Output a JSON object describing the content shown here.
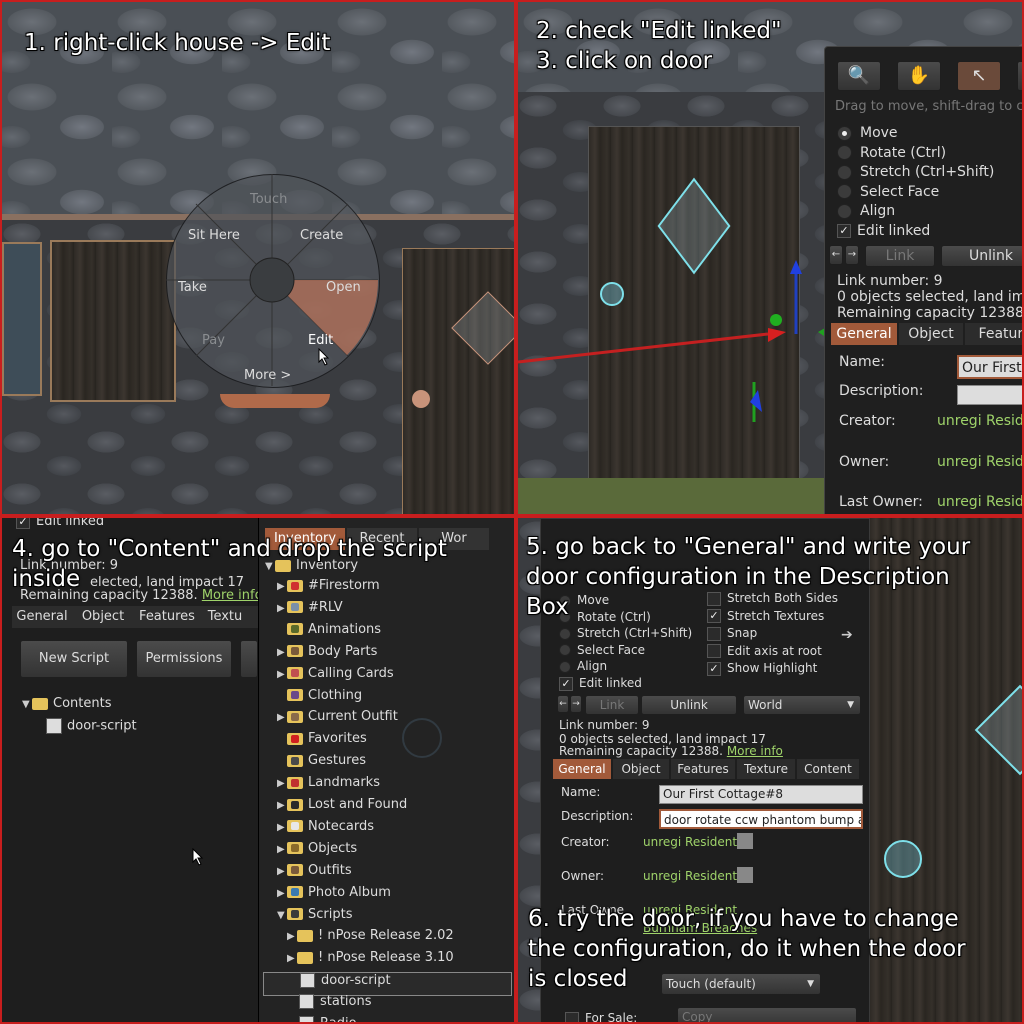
{
  "steps": {
    "s1": "1. right-click house -> Edit",
    "s2": "2. check \"Edit linked\"\n3. click on door",
    "s4": "4. go to \"Content\" and drop the script\ninside",
    "s5": "5. go back to \"General\" and write your\ndoor configuration in the Description\nBox",
    "s6": "6. try the door, if you have to change\nthe configuration, do it when the door\nis closed"
  },
  "pie_menu": {
    "top": "Touch",
    "top_left": "Sit Here",
    "top_right": "Create",
    "left": "Take",
    "right": "Open",
    "bottom_left": "Pay",
    "bottom_right": "Edit",
    "bottom": "More >"
  },
  "edit_tool": {
    "hint": "Drag to move, shift-drag to c",
    "modes": [
      "Move",
      "Rotate (Ctrl)",
      "Stretch (Ctrl+Shift)",
      "Select Face",
      "Align"
    ],
    "edit_linked": "Edit linked",
    "link_btn": "Link",
    "unlink_btn": "Unlink",
    "link_number": "Link number: 9",
    "objects_selected": "0 objects selected, land imp",
    "remaining": "Remaining capacity 12388.",
    "tabs": [
      "General",
      "Object",
      "Feature"
    ],
    "name_label": "Name:",
    "name_value": "Our First C",
    "description_label": "Description:",
    "creator_label": "Creator:",
    "creator_value": "unregi Reside",
    "owner_label": "Owner:",
    "owner_value": "unregi Reside",
    "last_owner_label": "Last Owner:",
    "last_owner_value": "unregi Reside"
  },
  "content_panel": {
    "edit_linked": "Edit linked",
    "link_number": "Link number: 9",
    "selected_text": "elected, land impact 17",
    "remaining": "Remaining capacity 12388.",
    "more_info": "More info",
    "tabs": [
      "General",
      "Object",
      "Features",
      "Textu"
    ],
    "new_script": "New Script",
    "permissions": "Permissions",
    "folder": "Contents",
    "script": "door-script"
  },
  "inventory": {
    "tabs": [
      "Inventory",
      "Recent",
      "Wor"
    ],
    "root": "Inventory",
    "items": [
      {
        "label": "#Firestorm",
        "color": "#d03030",
        "expand": true
      },
      {
        "label": "#RLV",
        "color": "#7a8fa8",
        "expand": true
      },
      {
        "label": "Animations",
        "color": "#5a6a2a",
        "expand": false
      },
      {
        "label": "Body Parts",
        "color": "#7a5a3a",
        "expand": true
      },
      {
        "label": "Calling Cards",
        "color": "#c05050",
        "expand": true
      },
      {
        "label": "Clothing",
        "color": "#6a4a8a",
        "expand": false
      },
      {
        "label": "Current Outfit",
        "color": "#8a6a4a",
        "expand": true
      },
      {
        "label": "Favorites",
        "color": "#d02020",
        "expand": false
      },
      {
        "label": "Gestures",
        "color": "#4a4a4a",
        "expand": false
      },
      {
        "label": "Landmarks",
        "color": "#c03030",
        "expand": true
      },
      {
        "label": "Lost and Found",
        "color": "#2a2a2a",
        "expand": true
      },
      {
        "label": "Notecards",
        "color": "#e8e8e8",
        "expand": true
      },
      {
        "label": "Objects",
        "color": "#8a6a2a",
        "expand": true
      },
      {
        "label": "Outfits",
        "color": "#7a5a3a",
        "expand": true
      },
      {
        "label": "Photo Album",
        "color": "#3a7ab0",
        "expand": true
      },
      {
        "label": "Scripts",
        "color": "#3a3a3a",
        "expand": true
      }
    ],
    "script_children": [
      "! nPose Release 2.02",
      "! nPose Release 3.10",
      "door-script",
      "stations",
      "Radio"
    ]
  },
  "general_panel": {
    "modes": [
      "Move",
      "Rotate (Ctrl)",
      "Stretch (Ctrl+Shift)",
      "Select Face",
      "Align"
    ],
    "options": [
      "Stretch Both Sides",
      "Stretch Textures",
      "Snap",
      "Edit axis at root",
      "Show Highlight"
    ],
    "options_checked": [
      false,
      true,
      false,
      false,
      true
    ],
    "edit_linked": "Edit linked",
    "link_btn": "Link",
    "unlink_btn": "Unlink",
    "world": "World",
    "link_number": "Link number: 9",
    "objects_selected": "0 objects selected, land impact 17",
    "remaining": "Remaining capacity 12388.",
    "more_info": "More info",
    "tabs": [
      "General",
      "Object",
      "Features",
      "Texture",
      "Content"
    ],
    "name_label": "Name:",
    "name_value": "Our First Cottage#8",
    "description_label": "Description:",
    "description_value": "door rotate ccw phantom bump aut",
    "creator_label": "Creator:",
    "creator_value": "unregi Resident",
    "owner_label": "Owner:",
    "owner_value": "unregi Resident",
    "last_owner_label": "Last Owne",
    "last_owner_value": "unregi Resident",
    "group_value": "Burnham Breaches",
    "touch": "Touch  (default)",
    "for_sale": "For Sale:",
    "copy": "Copy"
  },
  "colors": {
    "panel_border": "#c81e1e",
    "active_tab": "#a25a3a",
    "link_green": "#9fd36a"
  }
}
